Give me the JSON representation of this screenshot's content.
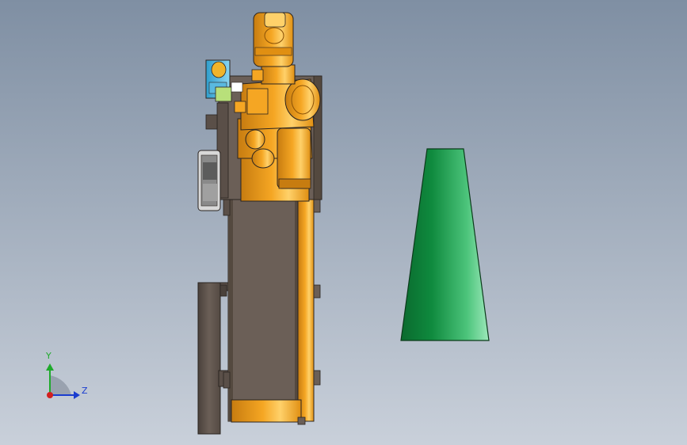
{
  "viewport": {
    "background_top": "#7f8fa3",
    "background_bottom": "#c9d0da"
  },
  "colors": {
    "robot_orange": "#f5a623",
    "robot_orange_dark": "#c77c10",
    "robot_orange_light": "#ffd16a",
    "base_gray": "#6b5f57",
    "base_gray_dark": "#3d3632",
    "outline": "#2a2420",
    "tool_blue": "#49b9e6",
    "tool_green": "#b8e07a",
    "cone_dark": "#0f8a3e",
    "cone_light": "#7fe0a5"
  },
  "triad": {
    "y_label": "Y",
    "z_label": "Z",
    "y_color": "#1faa2c",
    "z_color": "#1a3ccf",
    "origin_color": "#d21f1f",
    "icon": "coordinate-triad-icon"
  }
}
